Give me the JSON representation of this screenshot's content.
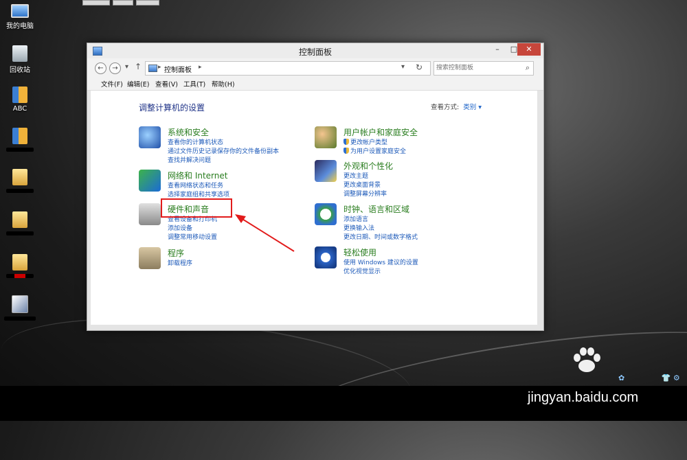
{
  "desktop": {
    "icons": [
      {
        "label": "我的电脑",
        "icon": "computer-icon"
      },
      {
        "label": "回收站",
        "icon": "recycle-bin-icon"
      },
      {
        "label": "ABC",
        "icon": "book-icon"
      }
    ]
  },
  "window": {
    "title": "控制面板",
    "close_glyph": "✕",
    "minimize_glyph": "–",
    "maximize_glyph": "□"
  },
  "address_bar": {
    "breadcrumb": "控制面板",
    "search_placeholder": "搜索控制面板"
  },
  "menu": [
    "文件(F)",
    "编辑(E)",
    "查看(V)",
    "工具(T)",
    "帮助(H)"
  ],
  "content": {
    "heading": "调整计算机的设置",
    "view_by_label": "查看方式:",
    "view_by_value": "类别 ▾",
    "categories_left": [
      {
        "title": "系统和安全",
        "icon": "security-shield-icon",
        "links": [
          "查看你的计算机状态",
          "通过文件历史记录保存你的文件备份副本",
          "查找并解决问题"
        ]
      },
      {
        "title": "网络和 Internet",
        "icon": "network-globe-icon",
        "links": [
          "查看网络状态和任务",
          "选择家庭组和共享选项"
        ]
      },
      {
        "title": "硬件和声音",
        "icon": "printer-speaker-icon",
        "links": [
          "查看设备和打印机",
          "添加设备",
          "调整常用移动设置"
        ]
      },
      {
        "title": "程序",
        "icon": "programs-icon",
        "links": [
          "卸载程序"
        ]
      }
    ],
    "categories_right": [
      {
        "title": "用户帐户和家庭安全",
        "icon": "users-icon",
        "links": [
          "更改帐户类型",
          "为用户设置家庭安全"
        ]
      },
      {
        "title": "外观和个性化",
        "icon": "appearance-icon",
        "links": [
          "更改主题",
          "更改桌面背景",
          "调整屏幕分辨率"
        ]
      },
      {
        "title": "时钟、语言和区域",
        "icon": "clock-globe-icon",
        "links": [
          "添加语言",
          "更换输入法",
          "更改日期、时间或数字格式"
        ]
      },
      {
        "title": "轻松使用",
        "icon": "ease-of-access-icon",
        "links": [
          "使用 Windows 建议的设置",
          "优化视觉显示"
        ]
      }
    ]
  },
  "annotation": {
    "highlight_color": "#e21b1b"
  },
  "watermark": {
    "logo": "Bai du 经验",
    "site": "jingyan.baidu.com"
  }
}
